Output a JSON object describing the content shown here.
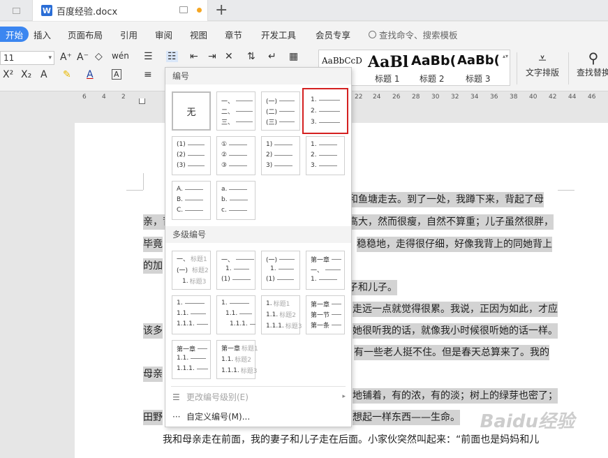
{
  "tabbar": {
    "doc_icon": "W",
    "doc_title": "百度经验.docx",
    "new_tab": "+"
  },
  "menubar": {
    "items": [
      "开始",
      "插入",
      "页面布局",
      "引用",
      "审阅",
      "视图",
      "章节",
      "开发工具",
      "会员专享"
    ],
    "search": "查找命令、搜索模板"
  },
  "toolbar": {
    "font_size": "11",
    "styles": [
      {
        "sample": "AaBbCcD",
        "label": ""
      },
      {
        "sample": "AaBl",
        "label": "标题 1"
      },
      {
        "sample": "AaBb(",
        "label": "标题 2"
      },
      {
        "sample": "AaBb(",
        "label": "标题 3"
      }
    ],
    "text_layout_label": "文字排版",
    "find_replace_label": "查找替换"
  },
  "ruler": {
    "numbers": [
      "6",
      "4",
      "2",
      "22",
      "24",
      "26",
      "28",
      "30",
      "32",
      "34",
      "36",
      "38",
      "40",
      "42",
      "44",
      "46"
    ]
  },
  "document": {
    "lines": [
      "和鱼塘走去。到了一处，我蹲下来，背起了母",
      "亲，背",
      "高大，然而很瘦，自然不算重；儿子虽然很胖，",
      "毕竟",
      "稳稳地，走得很仔细，好像我背上的同她背上",
      "的加",
      "子和儿子。",
      "走远一点就觉得很累。我说，正因为如此，才应",
      "该多",
      "她很听我的话，就像我小时候很听她的话一样。",
      "有一些老人挺不住。但是春天总算来了。我的",
      "母亲",
      "地铺着，有的浓，有的淡；树上的绿芽也密了；",
      "田野",
      "想起一样东西——生命。",
      "我和母亲走在前面，我的妻子和儿子走在后面。小家伙突然叫起来：“前面也是妈妈和儿"
    ]
  },
  "watermark": "Baidu经验",
  "dropdown": {
    "section_numbering": "编号",
    "section_multilevel": "多级编号",
    "none_label": "无",
    "change_level": "更改编号级别(E)",
    "custom_numbering": "自定义编号(M)...",
    "tiles": {
      "t2": [
        "一、",
        "二、",
        "三、"
      ],
      "t3": [
        "(一)",
        "(二)",
        "(三)"
      ],
      "t4": [
        "1.",
        "2.",
        "3."
      ],
      "t5": [
        "(1)",
        "(2)",
        "(3)"
      ],
      "t6": [
        "①",
        "②",
        "③"
      ],
      "t7": [
        "1)",
        "2)",
        "3)"
      ],
      "t8": [
        "1.",
        "2.",
        "3."
      ],
      "t9": [
        "A.",
        "B.",
        "C."
      ],
      "t10": [
        "a.",
        "b.",
        "c."
      ],
      "m1": [
        "一、",
        "标题1",
        "(一)",
        "标题2",
        "1.",
        "标题3"
      ],
      "m2": [
        "一、",
        "1.",
        "(1)"
      ],
      "m3": [
        "(一)",
        "1.",
        "(1)"
      ],
      "m4": [
        "第一章",
        "一、",
        "1."
      ],
      "m5": [
        "1.",
        "1.1.",
        "1.1.1."
      ],
      "m6": [
        "1.",
        "1.1.",
        "1.1.1."
      ],
      "m7": [
        "1.",
        "标题1",
        "1.1.",
        "标题2",
        "1.1.1.",
        "标题3"
      ],
      "m8": [
        "第一章",
        "第一节",
        "第一条"
      ],
      "m9": [
        "第一章",
        "1.1.",
        "1.1.1."
      ],
      "m10": [
        "第一章",
        "标题1",
        "1.1.",
        "标题2",
        "1.1.1.",
        "标题3"
      ]
    }
  }
}
